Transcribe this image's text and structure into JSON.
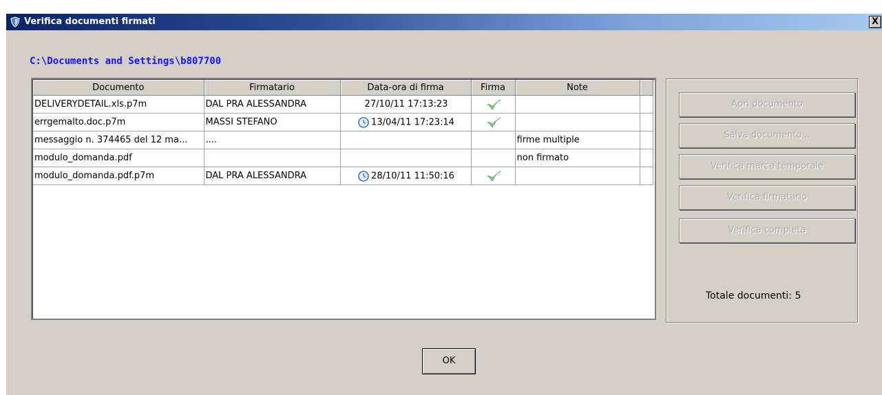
{
  "window": {
    "title": "Verifica documenti firmati",
    "close_label": "X"
  },
  "path": "C:\\Documents and Settings\\b807700",
  "table": {
    "columns": [
      "Documento",
      "Firmatario",
      "Data-ora di firma",
      "Firma",
      "Note"
    ],
    "rows": [
      {
        "documento": "DELIVERYDETAIL.xls.p7m",
        "firmatario": "DAL PRA ALESSANDRA",
        "data": "27/10/11 17:13:23",
        "clock": false,
        "firma": true,
        "note": ""
      },
      {
        "documento": "errgemalto.doc.p7m",
        "firmatario": "MASSI STEFANO",
        "data": "13/04/11 17:23:14",
        "clock": true,
        "firma": true,
        "note": ""
      },
      {
        "documento": "messaggio n. 374465 del 12 ma...",
        "firmatario": "....",
        "data": "",
        "clock": false,
        "firma": false,
        "note": "firme multiple"
      },
      {
        "documento": "modulo_domanda.pdf",
        "firmatario": "",
        "data": "",
        "clock": false,
        "firma": false,
        "note": "non firmato"
      },
      {
        "documento": "modulo_domanda.pdf.p7m",
        "firmatario": "DAL PRA ALESSANDRA",
        "data": "28/10/11 11:50:16",
        "clock": true,
        "firma": true,
        "note": ""
      }
    ]
  },
  "actions": {
    "apri": "Apri documento",
    "salva": "Salva documento...",
    "verifica_marca": "Verifica marca temporale",
    "verifica_firmatario": "Verifica firmatario",
    "verifica_completa": "Verifica completa"
  },
  "totale": "Totale documenti: 5",
  "ok_label": "OK",
  "icons": {
    "title": "shield-icon",
    "timestamp": "clock-icon",
    "signature_valid": "checkmark-icon",
    "close": "close-icon"
  },
  "colors": {
    "title_start": "#0a246a",
    "title_end": "#a6caf0",
    "path_text": "#1414ff",
    "check": "#3cb43c",
    "face": "#d4d0c8"
  }
}
